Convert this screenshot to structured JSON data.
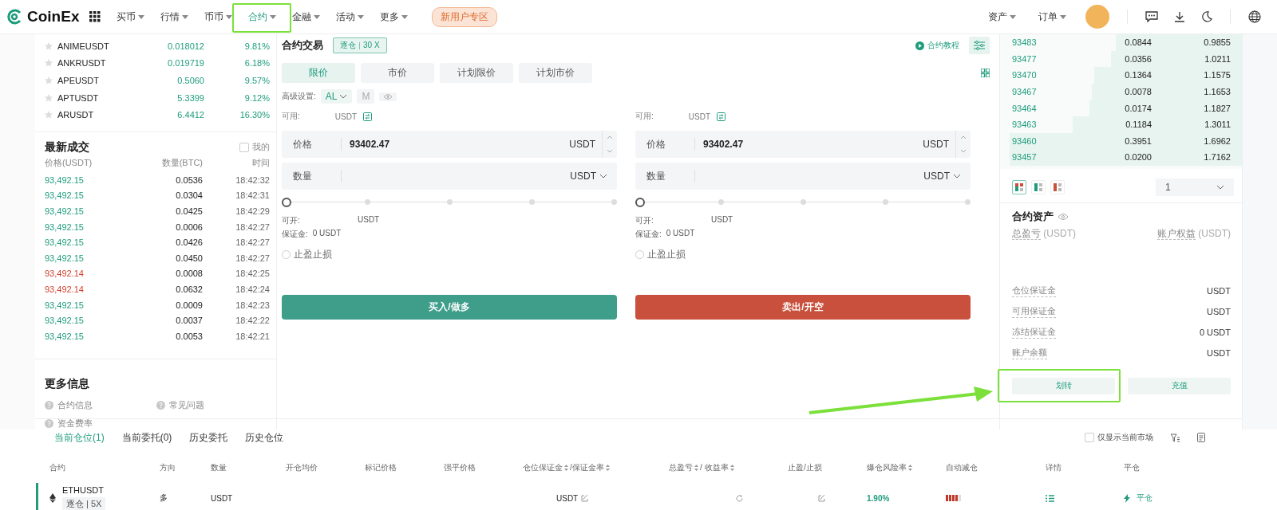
{
  "nav": {
    "logo": "CoinEx",
    "items": [
      {
        "label": "买币",
        "selected": false
      },
      {
        "label": "行情",
        "selected": false
      },
      {
        "label": "币币",
        "selected": false
      },
      {
        "label": "合约",
        "selected": true
      },
      {
        "label": "金融",
        "selected": false
      },
      {
        "label": "活动",
        "selected": false
      },
      {
        "label": "更多",
        "selected": false
      }
    ],
    "promo": "新用户专区",
    "right_items": [
      "资产",
      "订单"
    ]
  },
  "market_list": [
    {
      "symbol": "ANIMEUSDT",
      "price": "0.018012",
      "change": "9.81%"
    },
    {
      "symbol": "ANKRUSDT",
      "price": "0.019719",
      "change": "6.18%"
    },
    {
      "symbol": "APEUSDT",
      "price": "0.5060",
      "change": "9.57%"
    },
    {
      "symbol": "APTUSDT",
      "price": "5.3399",
      "change": "9.12%"
    },
    {
      "symbol": "ARUSDT",
      "price": "6.4412",
      "change": "16.30%"
    }
  ],
  "trades": {
    "title": "最新成交",
    "mine_label": "我的",
    "mine_checked": false,
    "columns": [
      "价格(USDT)",
      "数量(BTC)",
      "时间"
    ],
    "rows": [
      {
        "price": "93,492.15",
        "amount": "0.0536",
        "time": "18:42:32",
        "kind": "buy"
      },
      {
        "price": "93,492.15",
        "amount": "0.0304",
        "time": "18:42:31",
        "kind": "buy"
      },
      {
        "price": "93,492.15",
        "amount": "0.0425",
        "time": "18:42:29",
        "kind": "buy"
      },
      {
        "price": "93,492.15",
        "amount": "0.0006",
        "time": "18:42:27",
        "kind": "buy"
      },
      {
        "price": "93,492.15",
        "amount": "0.0426",
        "time": "18:42:27",
        "kind": "buy"
      },
      {
        "price": "93,492.15",
        "amount": "0.0450",
        "time": "18:42:27",
        "kind": "buy"
      },
      {
        "price": "93,492.14",
        "amount": "0.0008",
        "time": "18:42:25",
        "kind": "sell"
      },
      {
        "price": "93,492.14",
        "amount": "0.0632",
        "time": "18:42:24",
        "kind": "sell"
      },
      {
        "price": "93,492.15",
        "amount": "0.0009",
        "time": "18:42:23",
        "kind": "buy"
      },
      {
        "price": "93,492.15",
        "amount": "0.0037",
        "time": "18:42:22",
        "kind": "buy"
      },
      {
        "price": "93,492.15",
        "amount": "0.0053",
        "time": "18:42:21",
        "kind": "buy"
      }
    ]
  },
  "more_info": {
    "title": "更多信息",
    "links": [
      "合约信息",
      "常见问题",
      "资金费率"
    ]
  },
  "trade_panel": {
    "title": "合约交易",
    "margin_mode": "逐仓",
    "leverage": "30 X",
    "tutorial": "合约教程",
    "order_types": [
      {
        "label": "限价",
        "selected": true
      },
      {
        "label": "市价",
        "selected": false
      },
      {
        "label": "计划限价",
        "selected": false
      },
      {
        "label": "计划市价",
        "selected": false
      }
    ],
    "advanced_label": "高级设置:",
    "mode": "AL",
    "mode_m": "M",
    "sides": [
      {
        "kind": "buy",
        "available_label": "可用:",
        "available_unit": "USDT",
        "price_label": "价格",
        "price_value": "93402.47",
        "price_unit": "USDT",
        "qty_label": "数量",
        "qty_unit": "USDT",
        "level": 0,
        "open_label": "可开:",
        "open_unit": "USDT",
        "margin_label": "保证金:",
        "margin_value": "0 USDT",
        "tpsl_label": "止盈止损",
        "tpsl_checked": false,
        "button": "买入/做多"
      },
      {
        "kind": "sell",
        "available_label": "可用:",
        "available_unit": "USDT",
        "price_label": "价格",
        "price_value": "93402.47",
        "price_unit": "USDT",
        "qty_label": "数量",
        "qty_unit": "USDT",
        "level": 0,
        "open_label": "可开:",
        "open_unit": "USDT",
        "margin_label": "保证金:",
        "margin_value": "0 USDT",
        "tpsl_label": "止盈止损",
        "tpsl_checked": false,
        "button": "卖出/开空"
      }
    ]
  },
  "orderbook": {
    "rows": [
      {
        "price": "93483",
        "amount": "0.0844",
        "total": "0.9855",
        "level": 0.52
      },
      {
        "price": "93477",
        "amount": "0.0356",
        "total": "1.0211",
        "level": 0.54
      },
      {
        "price": "93470",
        "amount": "0.1364",
        "total": "1.1575",
        "level": 0.61
      },
      {
        "price": "93467",
        "amount": "0.0078",
        "total": "1.1653",
        "level": 0.62
      },
      {
        "price": "93464",
        "amount": "0.0174",
        "total": "1.1827",
        "level": 0.63
      },
      {
        "price": "93463",
        "amount": "0.1184",
        "total": "1.3011",
        "level": 0.7
      },
      {
        "price": "93460",
        "amount": "0.3951",
        "total": "1.6962",
        "level": 0.96
      },
      {
        "price": "93457",
        "amount": "0.0200",
        "total": "1.7162",
        "level": 0.96
      }
    ],
    "views": [
      {
        "kind": "both",
        "selected": true
      },
      {
        "kind": "bids",
        "selected": false
      },
      {
        "kind": "asks",
        "selected": false
      }
    ],
    "precision": "1"
  },
  "assets": {
    "title": "合约资产",
    "pnl_label": "总盈亏",
    "pnl_unit": "(USDT)",
    "equity_label": "账户权益",
    "equity_unit": "(USDT)",
    "rows": [
      {
        "label": "仓位保证金",
        "value": "USDT"
      },
      {
        "label": "可用保证金",
        "value": "USDT"
      },
      {
        "label": "冻结保证金",
        "value": "0 USDT"
      },
      {
        "label": "账户余额",
        "value": "USDT"
      }
    ],
    "buttons": [
      "划转",
      "充值"
    ]
  },
  "positions": {
    "tabs": [
      {
        "label": "当前仓位(1)",
        "selected": true
      },
      {
        "label": "当前委托(0)",
        "selected": false
      },
      {
        "label": "历史委托",
        "selected": false
      },
      {
        "label": "历史仓位",
        "selected": false
      }
    ],
    "filter_label": "仅显示当前市场",
    "filter_checked": false,
    "columns": [
      {
        "labels": [
          "合约"
        ],
        "sortable": false
      },
      {
        "labels": [
          "方向"
        ],
        "sortable": false
      },
      {
        "labels": [
          "数量"
        ],
        "sortable": false
      },
      {
        "labels": [
          "开仓均价"
        ],
        "sortable": false
      },
      {
        "labels": [
          "标记价格"
        ],
        "sortable": false
      },
      {
        "labels": [
          "强平价格"
        ],
        "sortable": false
      },
      {
        "labels": [
          "仓位保证金",
          "/保证金率"
        ],
        "sortable": true
      },
      {
        "labels": [
          "总盈亏",
          "/ 收益率"
        ],
        "sortable": true
      },
      {
        "labels": [
          "止盈/止损"
        ],
        "sortable": false
      },
      {
        "labels": [
          "爆仓风险率"
        ],
        "sortable": true
      },
      {
        "labels": [
          "自动减仓"
        ],
        "sortable": false
      },
      {
        "labels": [
          "详情"
        ],
        "sortable": false
      },
      {
        "labels": [
          "平仓"
        ],
        "sortable": false
      }
    ],
    "rows": [
      {
        "symbol": "ETHUSDT",
        "mode": "逐仓 | 5X",
        "direction": "多",
        "amount": "USDT",
        "margin": "USDT",
        "risk": "1.90%",
        "level": 0.8,
        "action": "平仓"
      }
    ]
  }
}
